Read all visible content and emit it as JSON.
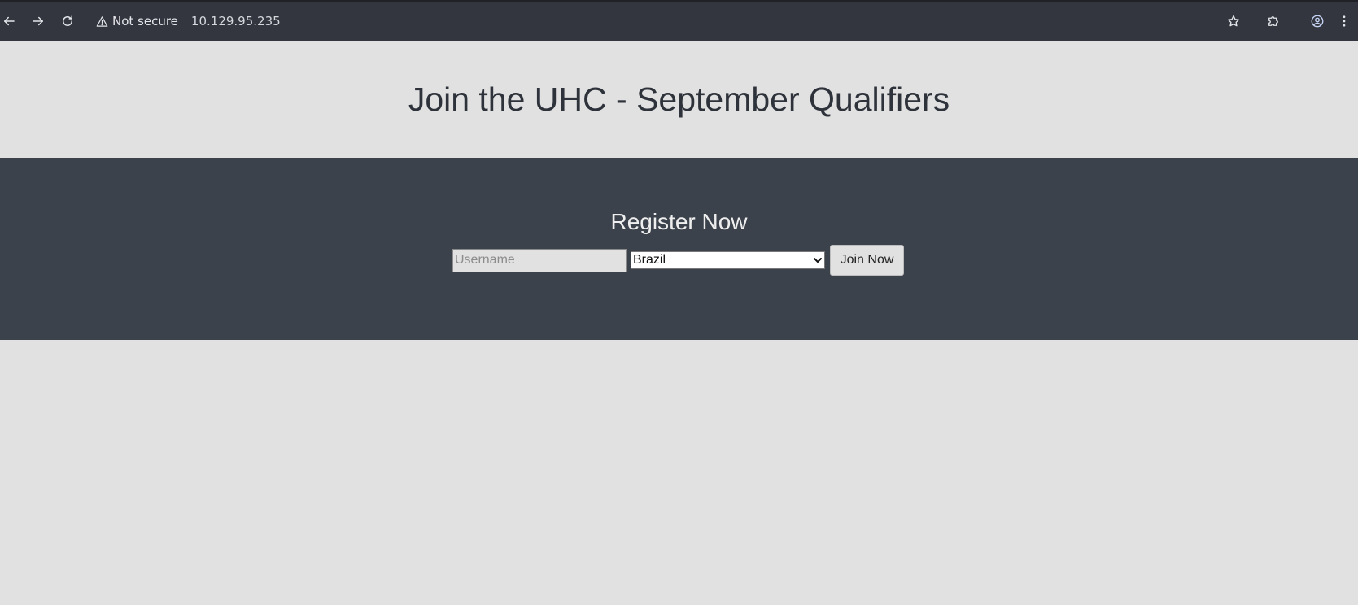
{
  "browser": {
    "security_label": "Not secure",
    "url": "10.129.95.235",
    "icons": {
      "back": "arrow-left-icon",
      "forward": "arrow-right-icon",
      "reload": "reload-icon",
      "warning": "warning-triangle-icon",
      "bookmark": "star-icon",
      "extensions": "puzzle-icon",
      "profile": "account-circle-icon",
      "menu": "kebab-menu-icon"
    }
  },
  "page": {
    "title": "Join the UHC - September Qualifiers",
    "register": {
      "heading": "Register Now",
      "username_placeholder": "Username",
      "country_selected": "Brazil",
      "join_button": "Join Now"
    }
  },
  "colors": {
    "toolbar_bg": "#33363e",
    "page_bg": "#e1e1e1",
    "register_band_bg": "#3c424b",
    "title_text": "#2e323a"
  }
}
